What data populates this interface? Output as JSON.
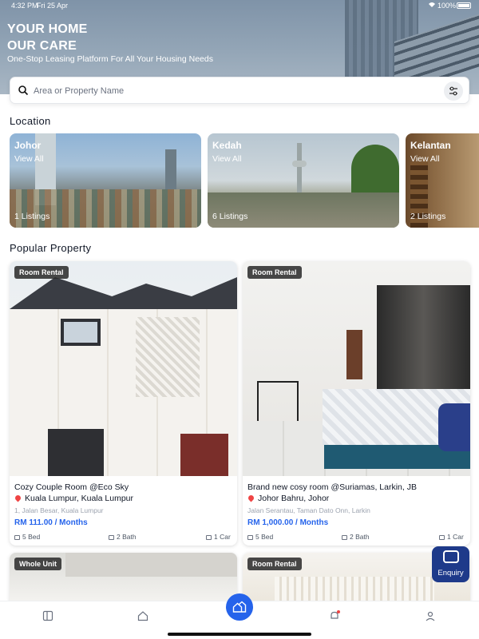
{
  "status": {
    "time": "4:32 PM",
    "date": "Fri 25 Apr",
    "battery": "100%"
  },
  "hero": {
    "title_line1": "YOUR HOME",
    "title_line2": "OUR CARE",
    "subtitle": "One-Stop Leasing Platform For All Your Housing Needs"
  },
  "search": {
    "placeholder": "Area or Property Name",
    "value": ""
  },
  "location": {
    "title": "Location",
    "cards": [
      {
        "name": "Johor",
        "view_all": "View All",
        "count": "1 Listings"
      },
      {
        "name": "Kedah",
        "view_all": "View All",
        "count": "6 Listings"
      },
      {
        "name": "Kelantan",
        "view_all": "View All",
        "count": "2 Listings"
      }
    ]
  },
  "popular": {
    "title": "Popular Property",
    "cards": [
      {
        "badge": "Room Rental",
        "title": "Cozy Couple Room @Eco Sky",
        "location": "Kuala Lumpur, Kuala Lumpur",
        "address": "1, Jalan Besar, Kuala Lumpur",
        "price": "RM 111.00 / Months",
        "bed": "5 Bed",
        "bath": "2 Bath",
        "car": "1 Car"
      },
      {
        "badge": "Room Rental",
        "title": "Brand new cosy room @Suriamas, Larkin, JB",
        "location": "Johor Bahru, Johor",
        "address": "Jalan Serantau, Taman Dato Onn, Larkin",
        "price": "RM 1,000.00 / Months",
        "bed": "5 Bed",
        "bath": "2 Bath",
        "car": "1 Car"
      },
      {
        "badge": "Whole Unit"
      },
      {
        "badge": "Room Rental"
      }
    ]
  },
  "enquiry": {
    "label": "Enquiry"
  },
  "icons": {
    "search": "search-icon",
    "filter": "filter-icon",
    "pin": "location-pin-icon",
    "bed": "bed-icon",
    "bath": "bath-icon",
    "car": "car-icon",
    "nav": [
      "listing-icon",
      "home-icon",
      "property-icon",
      "bell-icon",
      "profile-icon"
    ]
  },
  "colors": {
    "accent": "#2563eb",
    "enquiry": "#1e3a8a",
    "price": "#2563eb",
    "pin": "#ef4444",
    "notification_dot": "#ef4444"
  }
}
